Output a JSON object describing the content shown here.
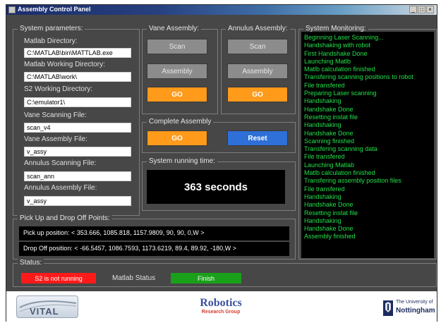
{
  "window": {
    "title": "Assembly Control Panel"
  },
  "system_params": {
    "title": "System parameters:",
    "matlab_dir_label": "Matlab Directory:",
    "matlab_dir_value": "C:\\MATLAB\\bin\\MATTLAB.exe",
    "matlab_work_label": "Matlab Working  Directory:",
    "matlab_work_value": "C:\\MATLAB\\work\\",
    "s2_work_label": "S2 Working Directory:",
    "s2_work_value": "C:\\emulator1\\",
    "vane_scan_label": "Vane Scanning File:",
    "vane_scan_value": "scan_v4",
    "vane_assy_label": "Vane Assembly File:",
    "vane_assy_value": "v_assy",
    "ann_scan_label": "Annulus Scanning File:",
    "ann_scan_value": "scan_ann",
    "ann_assy_label": "Annulus Assembly File:",
    "ann_assy_value": "v_assy"
  },
  "vane": {
    "title": "Vane Assembly:",
    "scan": "Scan",
    "assembly": "Assembly",
    "go": "GO"
  },
  "annulus": {
    "title": "Annulus Assembly:",
    "scan": "Scan",
    "assembly": "Assembly",
    "go": "GO"
  },
  "complete": {
    "title": "Complete Assembly",
    "go": "GO",
    "reset": "Reset"
  },
  "runtime": {
    "title": "System running time:",
    "value": "363 seconds"
  },
  "monitor": {
    "title": "System Monitoring:",
    "lines": [
      "Beginning Laser Scanning...",
      "Handshaking with robot",
      "First Handshake Done",
      "Launching Matlb",
      "Matlb calculation finished",
      "Transfering scanning positions to robot",
      "File transfered",
      "Preparing Laser scanning",
      "Handshaking",
      "Handshake Done",
      "Resetting instat file",
      "Handshaking",
      "Handshake Done",
      "Scanning finished",
      "Transfering scanning data",
      "File transfered",
      "Launching Matlab",
      "Matlb calculation finished",
      "Transfering assembly position files",
      "File transfered",
      "Handshaking",
      "Handshake Done",
      "Resetting instat file",
      "Handshaking",
      "Handshake Done",
      "Assembly finished"
    ]
  },
  "pickdrop": {
    "title": "Pick Up and Drop Off  Points:",
    "pick": "Pick up position: < 353.666, 1085.818, 1157.9809, 90, 90, 0,W >",
    "drop": "Drop Off position: < -66.5457, 1086.7593, 1173.6219, 89.4, 89.92, -180,W >"
  },
  "status": {
    "title": "Status:",
    "s2": "S2 is not running",
    "matlab_label": "Matlab Status",
    "matlab": "Finish",
    "colors": {
      "s2": "#ff1a1a",
      "matlab": "#1aa01a"
    }
  },
  "logos": {
    "vital": "VITAL",
    "robotics": "Robotics",
    "robotics_sub": "Research Group",
    "uni_line1": "The University of",
    "uni_line2": "Nottingham"
  }
}
